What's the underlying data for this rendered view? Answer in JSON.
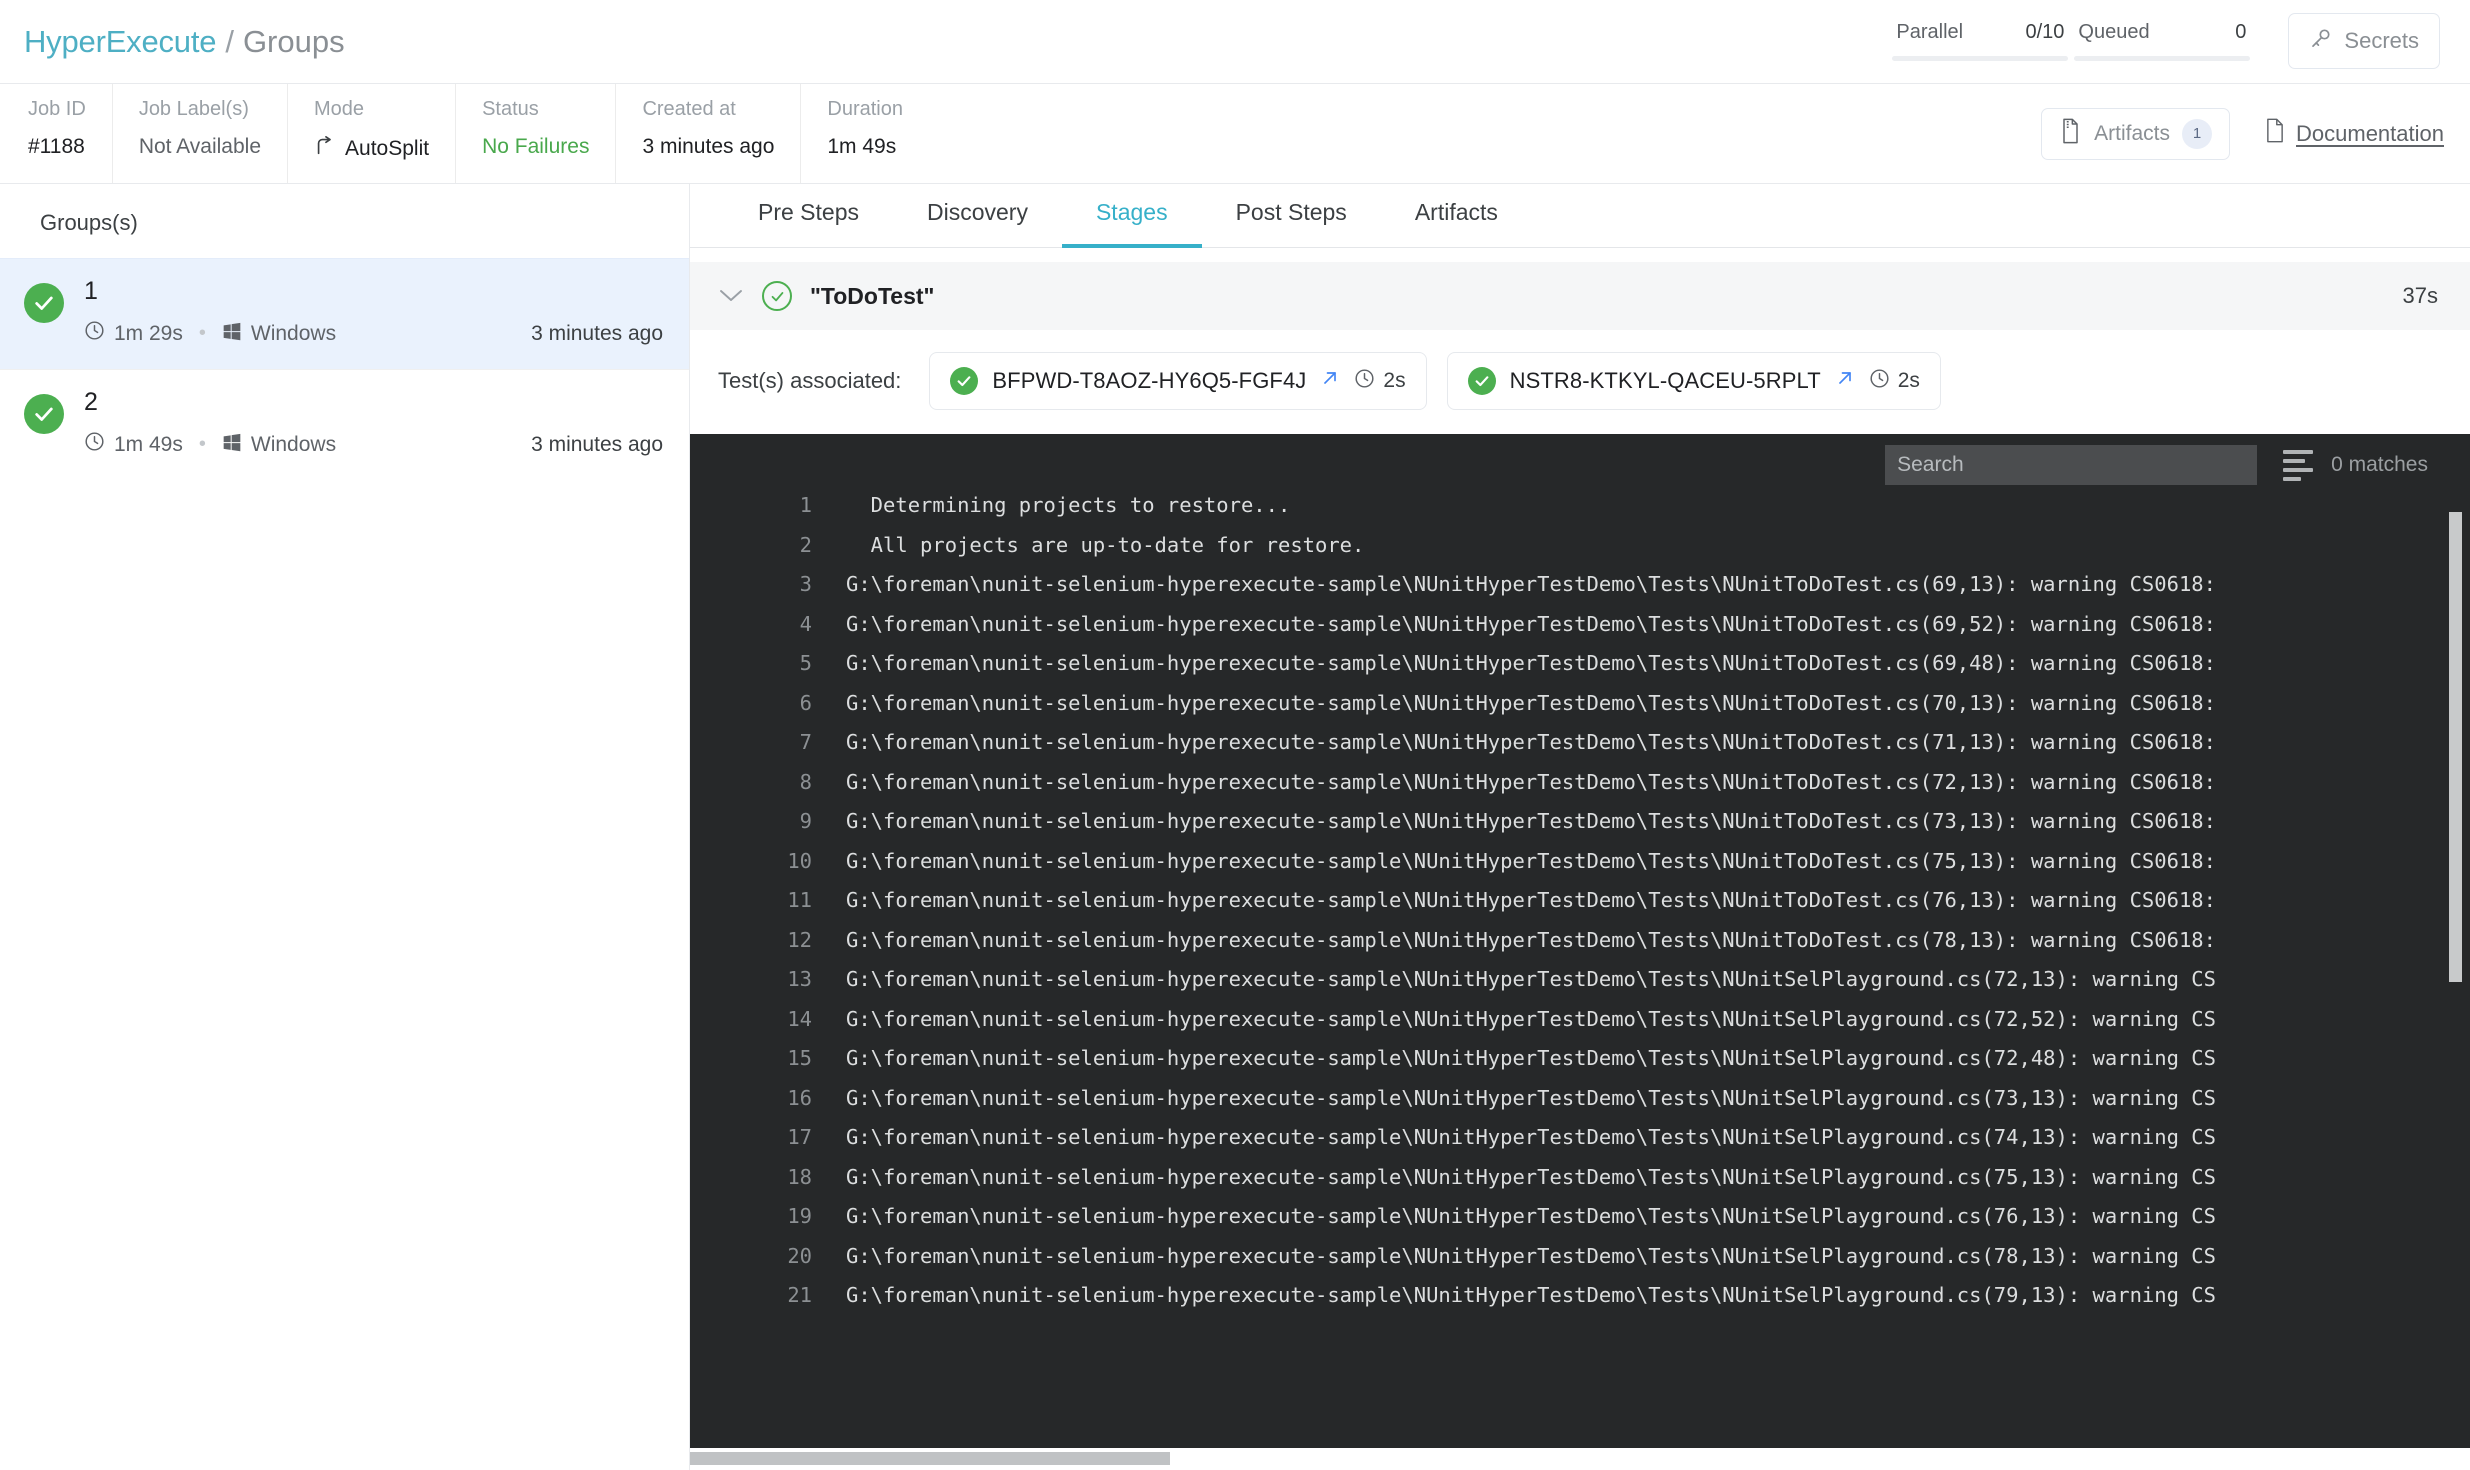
{
  "header": {
    "brand": "HyperExecute",
    "separator": "/",
    "current": "Groups",
    "parallel_label": "Parallel",
    "parallel_value": "0/10",
    "queued_label": "Queued",
    "queued_value": "0",
    "secrets_label": "Secrets",
    "brand_color": "#4eafc4"
  },
  "job": {
    "cells": [
      {
        "label": "Job ID",
        "value": "#1188",
        "style": "strong"
      },
      {
        "label": "Job Label(s)",
        "value": "Not Available",
        "style": "muted"
      },
      {
        "label": "Mode",
        "value": "AutoSplit",
        "style": "strong",
        "icon": "branch-icon"
      },
      {
        "label": "Status",
        "value": "No Failures",
        "style": "ok"
      },
      {
        "label": "Created at",
        "value": "3 minutes ago",
        "style": "strong"
      },
      {
        "label": "Duration",
        "value": "1m 49s",
        "style": "strong"
      }
    ],
    "artifacts_label": "Artifacts",
    "artifacts_count": "1",
    "documentation_label": "Documentation"
  },
  "sidebar": {
    "title": "Groups(s)",
    "groups": [
      {
        "name": "1",
        "duration": "1m 29s",
        "platform": "Windows",
        "time": "3 minutes ago",
        "status": "passed",
        "selected": true
      },
      {
        "name": "2",
        "duration": "1m 49s",
        "platform": "Windows",
        "time": "3 minutes ago",
        "status": "passed",
        "selected": false
      }
    ]
  },
  "main": {
    "tabs": [
      {
        "label": "Pre Steps",
        "active": false
      },
      {
        "label": "Discovery",
        "active": false
      },
      {
        "label": "Stages",
        "active": true
      },
      {
        "label": "Post Steps",
        "active": false
      },
      {
        "label": "Artifacts",
        "active": false
      }
    ],
    "stage": {
      "name": "\"ToDoTest\"",
      "duration": "37s",
      "status": "passed"
    },
    "tests_label": "Test(s) associated:",
    "tests": [
      {
        "id": "BFPWD-T8AOZ-HY6Q5-FGF4J",
        "duration": "2s",
        "status": "passed"
      },
      {
        "id": "NSTR8-KTKYL-QACEU-5RPLT",
        "duration": "2s",
        "status": "passed"
      }
    ]
  },
  "console": {
    "search_placeholder": "Search",
    "search_value": "",
    "matches": "0 matches",
    "lines": [
      {
        "n": "1",
        "text": "  Determining projects to restore..."
      },
      {
        "n": "2",
        "text": "  All projects are up-to-date for restore."
      },
      {
        "n": "3",
        "text": "G:\\foreman\\nunit-selenium-hyperexecute-sample\\NUnitHyperTestDemo\\Tests\\NUnitToDoTest.cs(69,13): warning CS0618:"
      },
      {
        "n": "4",
        "text": "G:\\foreman\\nunit-selenium-hyperexecute-sample\\NUnitHyperTestDemo\\Tests\\NUnitToDoTest.cs(69,52): warning CS0618:"
      },
      {
        "n": "5",
        "text": "G:\\foreman\\nunit-selenium-hyperexecute-sample\\NUnitHyperTestDemo\\Tests\\NUnitToDoTest.cs(69,48): warning CS0618:"
      },
      {
        "n": "6",
        "text": "G:\\foreman\\nunit-selenium-hyperexecute-sample\\NUnitHyperTestDemo\\Tests\\NUnitToDoTest.cs(70,13): warning CS0618:"
      },
      {
        "n": "7",
        "text": "G:\\foreman\\nunit-selenium-hyperexecute-sample\\NUnitHyperTestDemo\\Tests\\NUnitToDoTest.cs(71,13): warning CS0618:"
      },
      {
        "n": "8",
        "text": "G:\\foreman\\nunit-selenium-hyperexecute-sample\\NUnitHyperTestDemo\\Tests\\NUnitToDoTest.cs(72,13): warning CS0618:"
      },
      {
        "n": "9",
        "text": "G:\\foreman\\nunit-selenium-hyperexecute-sample\\NUnitHyperTestDemo\\Tests\\NUnitToDoTest.cs(73,13): warning CS0618:"
      },
      {
        "n": "10",
        "text": "G:\\foreman\\nunit-selenium-hyperexecute-sample\\NUnitHyperTestDemo\\Tests\\NUnitToDoTest.cs(75,13): warning CS0618:"
      },
      {
        "n": "11",
        "text": "G:\\foreman\\nunit-selenium-hyperexecute-sample\\NUnitHyperTestDemo\\Tests\\NUnitToDoTest.cs(76,13): warning CS0618:"
      },
      {
        "n": "12",
        "text": "G:\\foreman\\nunit-selenium-hyperexecute-sample\\NUnitHyperTestDemo\\Tests\\NUnitToDoTest.cs(78,13): warning CS0618:"
      },
      {
        "n": "13",
        "text": "G:\\foreman\\nunit-selenium-hyperexecute-sample\\NUnitHyperTestDemo\\Tests\\NUnitSelPlayground.cs(72,13): warning CS"
      },
      {
        "n": "14",
        "text": "G:\\foreman\\nunit-selenium-hyperexecute-sample\\NUnitHyperTestDemo\\Tests\\NUnitSelPlayground.cs(72,52): warning CS"
      },
      {
        "n": "15",
        "text": "G:\\foreman\\nunit-selenium-hyperexecute-sample\\NUnitHyperTestDemo\\Tests\\NUnitSelPlayground.cs(72,48): warning CS"
      },
      {
        "n": "16",
        "text": "G:\\foreman\\nunit-selenium-hyperexecute-sample\\NUnitHyperTestDemo\\Tests\\NUnitSelPlayground.cs(73,13): warning CS"
      },
      {
        "n": "17",
        "text": "G:\\foreman\\nunit-selenium-hyperexecute-sample\\NUnitHyperTestDemo\\Tests\\NUnitSelPlayground.cs(74,13): warning CS"
      },
      {
        "n": "18",
        "text": "G:\\foreman\\nunit-selenium-hyperexecute-sample\\NUnitHyperTestDemo\\Tests\\NUnitSelPlayground.cs(75,13): warning CS"
      },
      {
        "n": "19",
        "text": "G:\\foreman\\nunit-selenium-hyperexecute-sample\\NUnitHyperTestDemo\\Tests\\NUnitSelPlayground.cs(76,13): warning CS"
      },
      {
        "n": "20",
        "text": "G:\\foreman\\nunit-selenium-hyperexecute-sample\\NUnitHyperTestDemo\\Tests\\NUnitSelPlayground.cs(78,13): warning CS"
      },
      {
        "n": "21",
        "text": "G:\\foreman\\nunit-selenium-hyperexecute-sample\\NUnitHyperTestDemo\\Tests\\NUnitSelPlayground.cs(79,13): warning CS"
      }
    ]
  }
}
